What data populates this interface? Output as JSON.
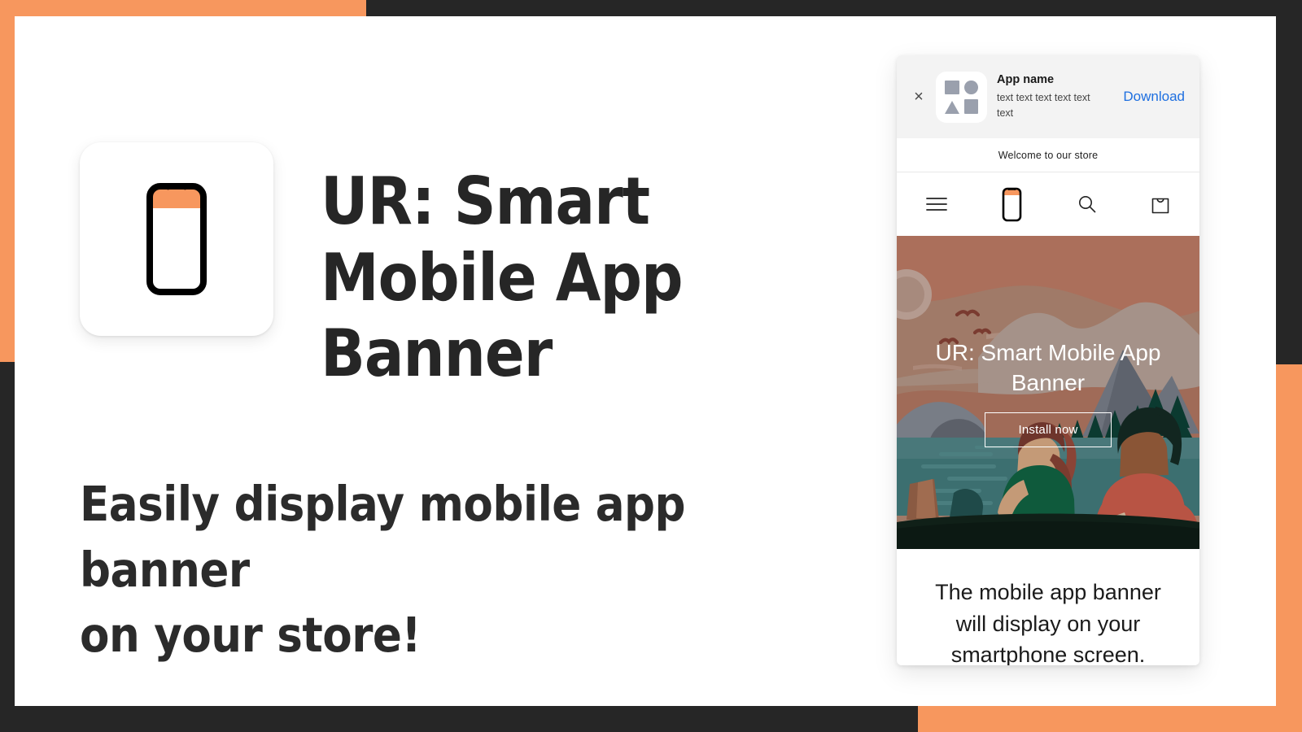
{
  "theme": {
    "orange": "#f7975e",
    "dark": "#262626",
    "link_blue": "#1e6fe0",
    "icon_gray": "#9aa0ad",
    "banner_bg": "#f3f3f3"
  },
  "hero": {
    "title": "UR: Smart\nMobile App Banner",
    "subheading": "Easily display mobile app banner\non your store!",
    "logo_icon": "mobile-phone-icon"
  },
  "phone_preview": {
    "app_banner": {
      "close_label": "×",
      "app_name": "App name",
      "app_description": "text text text text text text",
      "download_label": "Download",
      "icon_shapes": [
        "square",
        "circle",
        "triangle",
        "square"
      ]
    },
    "announcement": "Welcome to our store",
    "store_header": {
      "menu_icon": "hamburger-menu-icon",
      "logo_icon": "mobile-phone-icon",
      "search_icon": "search-icon",
      "cart_icon": "shopping-bag-icon"
    },
    "hero_section": {
      "heading": "UR: Smart Mobile App Banner",
      "button_label": "Install now",
      "illustration": "couple-in-canoe-on-lake-at-sunset"
    },
    "caption": "The mobile app banner will display on your smartphone screen."
  }
}
